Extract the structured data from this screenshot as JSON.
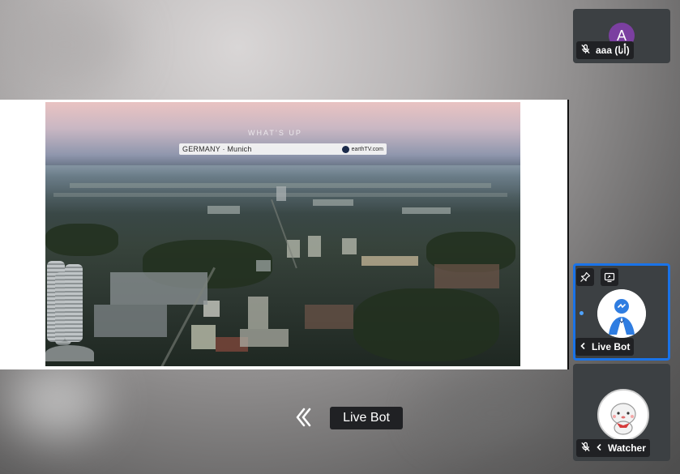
{
  "video": {
    "location_label": "GERMANY · Munich",
    "brand_label": "earthTV.com",
    "faint_title": "WHAT’S UP"
  },
  "active_speaker": {
    "name": "Live Bot"
  },
  "participants": [
    {
      "id": "aaa",
      "name": "aaa (أنا)",
      "avatar_letter": "A",
      "avatar_color": "#7b3fa0",
      "muted": true
    },
    {
      "id": "live-bot",
      "name": "Live Bot",
      "active": true,
      "accent": "#1a73e8"
    },
    {
      "id": "watcher",
      "name": "Watcher",
      "muted": true
    }
  ]
}
